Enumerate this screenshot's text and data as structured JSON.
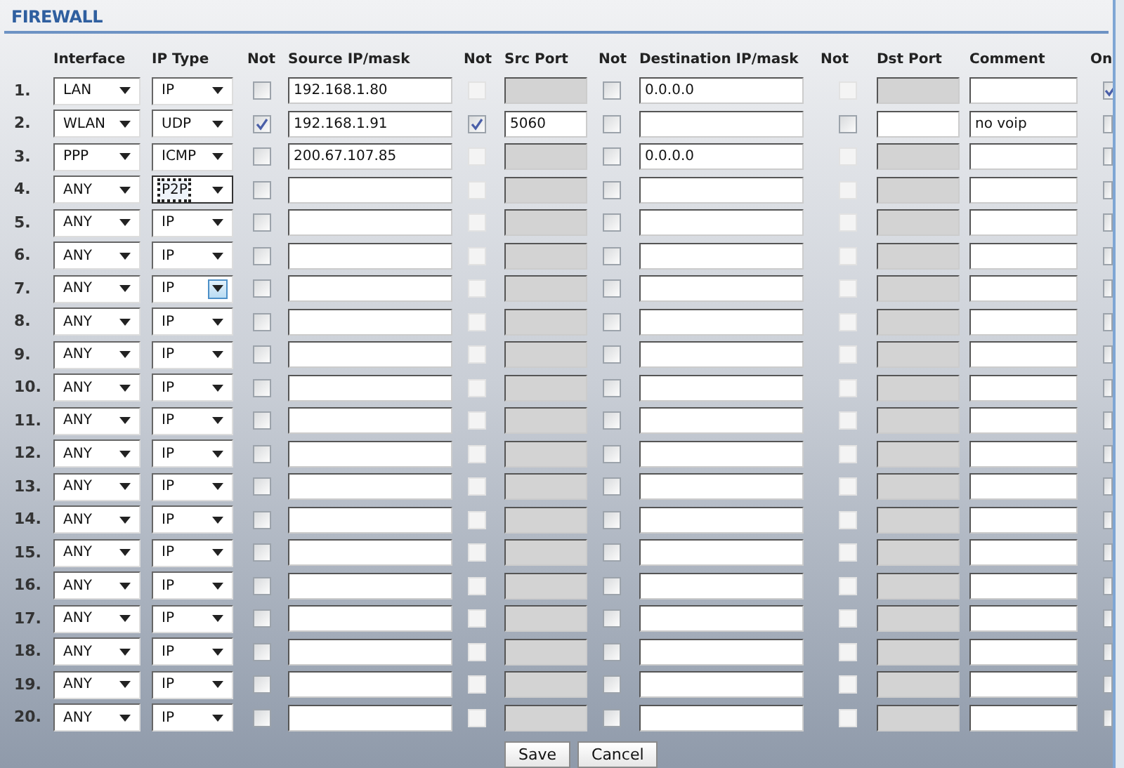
{
  "section_title": "FIREWALL",
  "columns": [
    "Interface",
    "IP Type",
    "Not",
    "Source IP/mask",
    "Not",
    "Src Port",
    "Not",
    "Destination IP/mask",
    "Not",
    "Dst Port",
    "Comment",
    "On"
  ],
  "rules": [
    {
      "number": "1.",
      "interface": "LAN",
      "ip_type": {
        "value": "IP",
        "focused": false,
        "hovered": false
      },
      "not_source": false,
      "source": "192.168.1.80",
      "ports_enabled": false,
      "not_src_port": false,
      "not_dest": false,
      "dest": "0.0.0.0",
      "not_dst_port": false,
      "on": true
    },
    {
      "number": "2.",
      "interface": "WLAN",
      "ip_type": {
        "value": "UDP",
        "focused": false,
        "hovered": false
      },
      "not_source": true,
      "source": "192.168.1.91",
      "ports_enabled": true,
      "not_src_port": true,
      "src_port": "5060",
      "not_dest": false,
      "not_dst_port": false,
      "comment": "no voip",
      "on": false
    },
    {
      "number": "3.",
      "interface": "PPP",
      "ip_type": {
        "value": "ICMP",
        "focused": false,
        "hovered": false
      },
      "not_source": false,
      "source": "200.67.107.85",
      "ports_enabled": false,
      "not_src_port": false,
      "not_dest": false,
      "dest": "0.0.0.0",
      "not_dst_port": false,
      "on": false
    },
    {
      "number": "4.",
      "interface": "ANY",
      "ip_type": {
        "value": "P2P",
        "focused": true,
        "hovered": false
      },
      "not_source": false,
      "ports_enabled": false,
      "not_src_port": false,
      "not_dest": false,
      "not_dst_port": false,
      "on": false
    },
    {
      "number": "5.",
      "interface": "ANY",
      "ip_type": {
        "value": "IP",
        "focused": false,
        "hovered": false
      },
      "not_source": false,
      "ports_enabled": false,
      "not_src_port": false,
      "not_dest": false,
      "not_dst_port": false,
      "on": false
    },
    {
      "number": "6.",
      "interface": "ANY",
      "ip_type": {
        "value": "IP",
        "focused": false,
        "hovered": false
      },
      "not_source": false,
      "ports_enabled": false,
      "not_src_port": false,
      "not_dest": false,
      "not_dst_port": false,
      "on": false
    },
    {
      "number": "7.",
      "interface": "ANY",
      "ip_type": {
        "value": "IP",
        "focused": false,
        "hovered": true
      },
      "not_source": false,
      "ports_enabled": false,
      "not_src_port": false,
      "not_dest": false,
      "not_dst_port": false,
      "on": false
    },
    {
      "number": "8.",
      "interface": "ANY",
      "ip_type": {
        "value": "IP",
        "focused": false,
        "hovered": false
      },
      "not_source": false,
      "ports_enabled": false,
      "not_src_port": false,
      "not_dest": false,
      "not_dst_port": false,
      "on": false
    },
    {
      "number": "9.",
      "interface": "ANY",
      "ip_type": {
        "value": "IP",
        "focused": false,
        "hovered": false
      },
      "not_source": false,
      "ports_enabled": false,
      "not_src_port": false,
      "not_dest": false,
      "not_dst_port": false,
      "on": false
    },
    {
      "number": "10.",
      "interface": "ANY",
      "ip_type": {
        "value": "IP",
        "focused": false,
        "hovered": false
      },
      "not_source": false,
      "ports_enabled": false,
      "not_src_port": false,
      "not_dest": false,
      "not_dst_port": false,
      "on": false
    },
    {
      "number": "11.",
      "interface": "ANY",
      "ip_type": {
        "value": "IP",
        "focused": false,
        "hovered": false
      },
      "not_source": false,
      "ports_enabled": false,
      "not_src_port": false,
      "not_dest": false,
      "not_dst_port": false,
      "on": false
    },
    {
      "number": "12.",
      "interface": "ANY",
      "ip_type": {
        "value": "IP",
        "focused": false,
        "hovered": false
      },
      "not_source": false,
      "ports_enabled": false,
      "not_src_port": false,
      "not_dest": false,
      "not_dst_port": false,
      "on": false
    },
    {
      "number": "13.",
      "interface": "ANY",
      "ip_type": {
        "value": "IP",
        "focused": false,
        "hovered": false
      },
      "not_source": false,
      "ports_enabled": false,
      "not_src_port": false,
      "not_dest": false,
      "not_dst_port": false,
      "on": false
    },
    {
      "number": "14.",
      "interface": "ANY",
      "ip_type": {
        "value": "IP",
        "focused": false,
        "hovered": false
      },
      "not_source": false,
      "ports_enabled": false,
      "not_src_port": false,
      "not_dest": false,
      "not_dst_port": false,
      "on": false
    },
    {
      "number": "15.",
      "interface": "ANY",
      "ip_type": {
        "value": "IP",
        "focused": false,
        "hovered": false
      },
      "not_source": false,
      "ports_enabled": false,
      "not_src_port": false,
      "not_dest": false,
      "not_dst_port": false,
      "on": false
    },
    {
      "number": "16.",
      "interface": "ANY",
      "ip_type": {
        "value": "IP",
        "focused": false,
        "hovered": false
      },
      "not_source": false,
      "ports_enabled": false,
      "not_src_port": false,
      "not_dest": false,
      "not_dst_port": false,
      "on": false
    },
    {
      "number": "17.",
      "interface": "ANY",
      "ip_type": {
        "value": "IP",
        "focused": false,
        "hovered": false
      },
      "not_source": false,
      "ports_enabled": false,
      "not_src_port": false,
      "not_dest": false,
      "not_dst_port": false,
      "on": false
    },
    {
      "number": "18.",
      "interface": "ANY",
      "ip_type": {
        "value": "IP",
        "focused": false,
        "hovered": false
      },
      "not_source": false,
      "ports_enabled": false,
      "not_src_port": false,
      "not_dest": false,
      "not_dst_port": false,
      "on": false
    },
    {
      "number": "19.",
      "interface": "ANY",
      "ip_type": {
        "value": "IP",
        "focused": false,
        "hovered": false
      },
      "not_source": false,
      "ports_enabled": false,
      "not_src_port": false,
      "not_dest": false,
      "not_dst_port": false,
      "on": false
    },
    {
      "number": "20.",
      "interface": "ANY",
      "ip_type": {
        "value": "IP",
        "focused": false,
        "hovered": false
      },
      "not_source": false,
      "ports_enabled": false,
      "not_src_port": false,
      "not_dest": false,
      "not_dst_port": false,
      "on": false
    }
  ],
  "buttons": [
    "Save",
    "Cancel"
  ]
}
